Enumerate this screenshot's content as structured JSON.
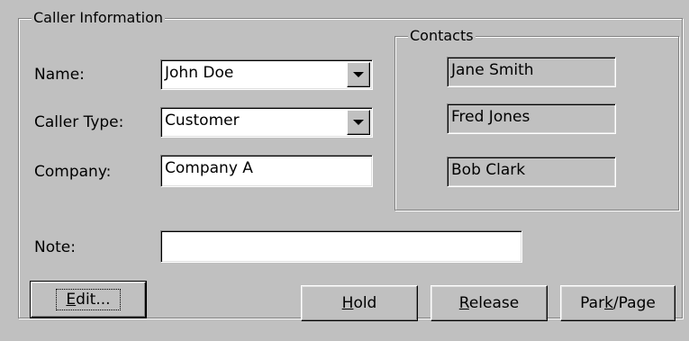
{
  "caller_info": {
    "legend": "Caller Information",
    "name_label": "Name:",
    "name_value": "John Doe",
    "caller_type_label": "Caller Type:",
    "caller_type_value": "Customer",
    "company_label": "Company:",
    "company_value": "Company A",
    "note_label": "Note:",
    "note_value": ""
  },
  "contacts": {
    "legend": "Contacts",
    "items": [
      "Jane Smith",
      "Fred Jones",
      "Bob Clark"
    ]
  },
  "buttons": {
    "edit": {
      "pre": "",
      "mn": "E",
      "post": "dit..."
    },
    "hold": {
      "pre": "",
      "mn": "H",
      "post": "old"
    },
    "release": {
      "pre": "",
      "mn": "R",
      "post": "elease"
    },
    "park": {
      "pre": "Par",
      "mn": "k",
      "post": "/Page"
    }
  },
  "icons": {
    "dropdown": "chevron-down-icon"
  }
}
